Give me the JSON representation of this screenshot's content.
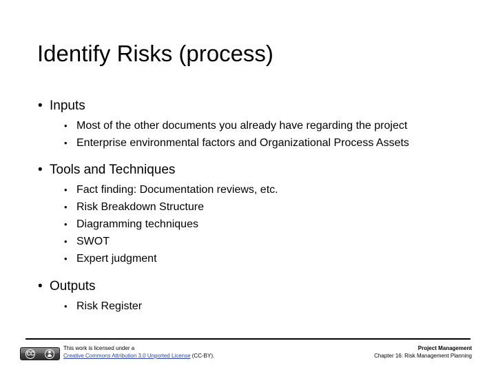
{
  "slide": {
    "title": "Identify Risks (process)",
    "bullet_glyph_level1": "•",
    "bullet_glyph_level2": "•",
    "sections": [
      {
        "heading": "Inputs",
        "items": [
          "Most of the other documents you already have regarding the project",
          "Enterprise environmental factors and Organizational Process Assets"
        ]
      },
      {
        "heading": "Tools and Techniques",
        "items": [
          "Fact finding: Documentation reviews, etc.",
          "Risk Breakdown Structure",
          "Diagramming techniques",
          "SWOT",
          "Expert judgment"
        ]
      },
      {
        "heading": "Outputs",
        "items": [
          "Risk Register"
        ]
      }
    ]
  },
  "footer": {
    "license_line1": "This work is licensed under a",
    "license_link": "Creative Commons Attribution 3.0 Unported License",
    "license_suffix": " (CC-BY).",
    "badge_cc_label": "CC",
    "right_line1": "Project Management",
    "right_line2": "Chapter 16: Risk Management Planning",
    "link_color": "#2a3fa4"
  }
}
